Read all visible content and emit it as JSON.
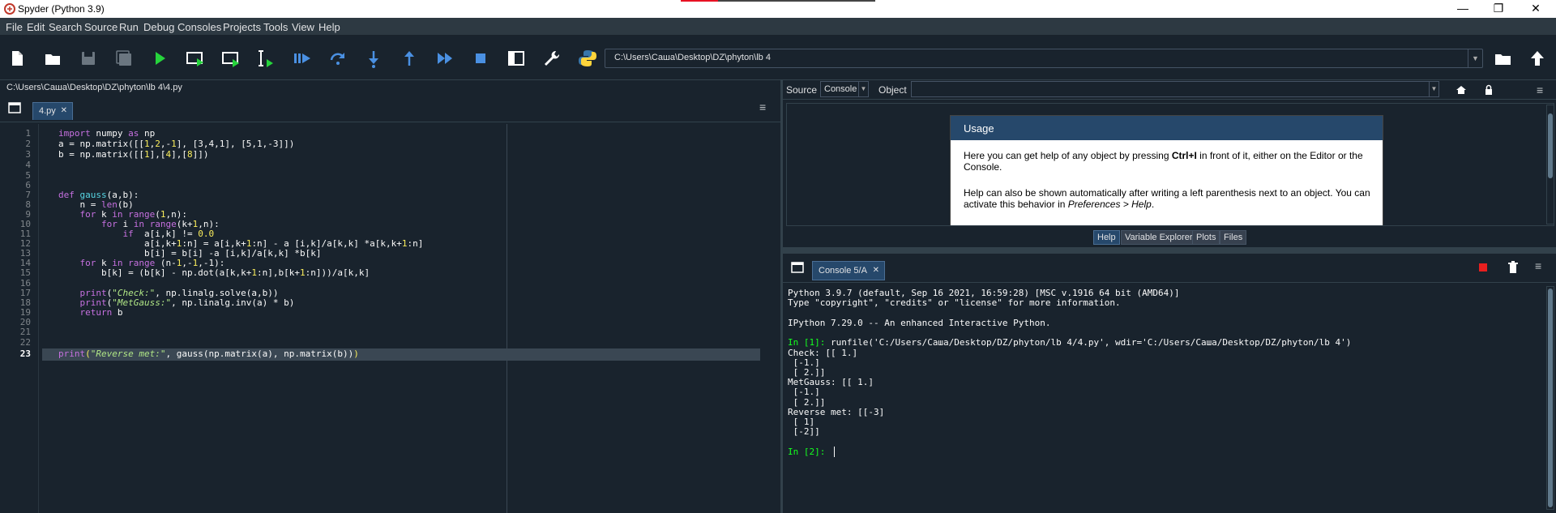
{
  "window": {
    "title": "Spyder (Python 3.9)",
    "minimize": "—",
    "maximize": "❐",
    "close": "✕"
  },
  "menu": [
    "File",
    "Edit",
    "Search",
    "Source",
    "Run",
    "Debug",
    "Consoles",
    "Projects",
    "Tools",
    "View",
    "Help"
  ],
  "toolbar": {
    "path": "C:\\Users\\Саша\\Desktop\\DZ\\phyton\\lb 4"
  },
  "editor": {
    "file_path": "C:\\Users\\Саша\\Desktop\\DZ\\phyton\\lb 4\\4.py",
    "tab_label": "4.py",
    "tab_close": "✕",
    "menu_glyph": "≡",
    "line_numbers": [
      "1",
      "2",
      "3",
      "4",
      "5",
      "6",
      "7",
      "8",
      "9",
      "10",
      "11",
      "12",
      "13",
      "14",
      "15",
      "16",
      "17",
      "18",
      "19",
      "20",
      "21",
      "22",
      "23"
    ],
    "current_line": "23"
  },
  "help": {
    "source_label": "Source",
    "source_value": "Console",
    "object_label": "Object",
    "usage_title": "Usage",
    "usage_p1a": "Here you can get help of any object by pressing ",
    "usage_p1b": "Ctrl+I",
    "usage_p1c": " in front of it, either on the Editor or the Console.",
    "usage_p2a": "Help can also be shown automatically after writing a left parenthesis next to an object. You can activate this behavior in ",
    "usage_p2b": "Preferences > Help",
    "usage_p2c": ".",
    "tabs": [
      "Help",
      "Variable Explorer",
      "Plots",
      "Files"
    ],
    "active_tab": "Help"
  },
  "console": {
    "tab_label": "Console 5/A",
    "tab_close": "✕",
    "menu_glyph": "≡",
    "lines": [
      "Python 3.9.7 (default, Sep 16 2021, 16:59:28) [MSC v.1916 64 bit (AMD64)]",
      "Type \"copyright\", \"credits\" or \"license\" for more information.",
      "",
      "IPython 7.29.0 -- An enhanced Interactive Python.",
      "",
      "runfile('C:/Users/Саша/Desktop/DZ/phyton/lb 4/4.py', wdir='C:/Users/Саша/Desktop/DZ/phyton/lb 4')",
      "Check: [[ 1.]",
      " [-1.]",
      " [ 2.]]",
      "MetGauss: [[ 1.]",
      " [-1.]",
      " [ 2.]]",
      "Reverse met: [[-3]",
      " [ 1]",
      " [-2]]",
      ""
    ],
    "prompt1": "In [1]: ",
    "prompt2": "In [2]: "
  },
  "colors": {
    "bg": "#19232d",
    "accent": "#26486b",
    "prompt": "#14ff1f",
    "stop": "#e81f1f"
  }
}
